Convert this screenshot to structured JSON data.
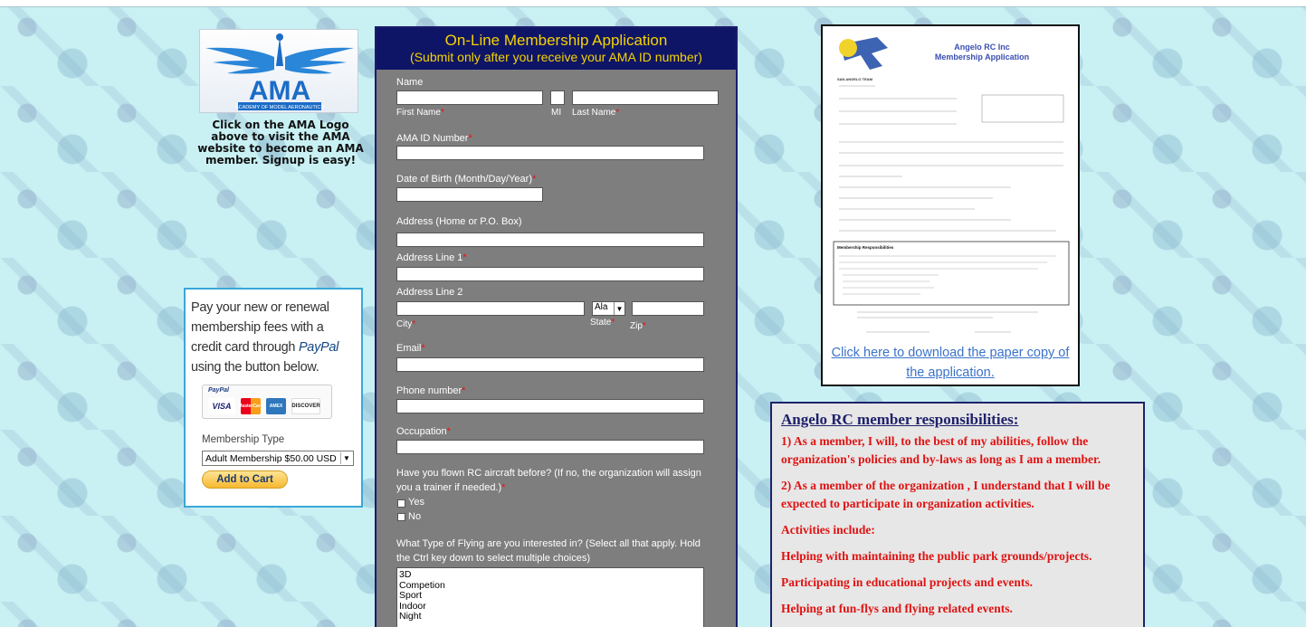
{
  "ama": {
    "logo_text": "AMA",
    "logo_sub": "ACADEMY OF MODEL AERONAUTICS",
    "caption_lines": [
      "Click on the AMA Logo",
      "above to visit the AMA",
      "website to become an AMA",
      "member. Signup is easy!"
    ]
  },
  "paypal": {
    "text_1": "Pay your new or renewal",
    "text_2": "membership fees with a",
    "text_3": "credit card through",
    "text_3_brand": "PayPal",
    "text_4": "using the button below.",
    "cards_brand": "PayPal",
    "cards": [
      "VISA",
      "MasterCard",
      "AMEX",
      "DISCOVER"
    ],
    "membership_label": "Membership Type",
    "membership_selected": "Adult Membership $50.00 USD",
    "add_to_cart": "Add to Cart"
  },
  "form": {
    "title": "On-Line Membership Application",
    "subtitle": "(Submit only after you receive your AMA ID number)",
    "name_label": "Name",
    "first_name_label": "First Name",
    "mi_label": "MI",
    "last_name_label": "Last Name",
    "ama_id_label": "AMA ID Number",
    "dob_label": "Date of Birth (Month/Day/Year)",
    "address_label": "Address (Home or P.O. Box)",
    "address_line1_label": "Address Line 1",
    "address_line2_label": "Address Line 2",
    "city_label": "City",
    "state_label": "State",
    "state_value": "Ala",
    "zip_label": "Zip",
    "email_label": "Email",
    "phone_label": "Phone number",
    "occupation_label": "Occupation",
    "flown_question_1": "Have you flown RC aircraft before? (If no, the organization will assign",
    "flown_question_2": "you a trainer if needed.)",
    "flown_yes": "Yes",
    "flown_no": "No",
    "flying_question_1": "What Type of Flying are you interested in? (Select all that apply. Hold",
    "flying_question_2": "the Ctrl key down to select multiple choices)",
    "flying_options": [
      "3D",
      "Competion",
      "Sport",
      "Indoor",
      "Night"
    ],
    "required_mark": "*"
  },
  "paper": {
    "title_1": "Angelo RC Inc",
    "title_2": "Membership Application",
    "team_label": "SAN ANGELO TEAM",
    "section_title": "Membership Responsibilities",
    "download_link": "Click here to download the paper copy of the application."
  },
  "responsibilities": {
    "heading": "Angelo RC member responsibilities:",
    "item_1": "1) As a member, I will, to the best of my abilities, follow the organization's policies and by-laws as long as I am a member.",
    "item_2": "2) As a member of the organization , I understand that I will be expected to participate in organization activities.",
    "activities_label": "Activities include:",
    "activity_1": "Helping with maintaining the public park grounds/projects.",
    "activity_2": "Participating in educational projects and events.",
    "activity_3": "Helping at fun-flys and flying related events."
  },
  "colors": {
    "background": "#c9f1f4",
    "form_header": "#0f1566",
    "form_title": "#f5d300",
    "form_body": "#7e7e7e",
    "required": "#e11111",
    "link": "#3b72c8",
    "resp_heading": "#1e226b",
    "resp_text": "#e01212"
  }
}
